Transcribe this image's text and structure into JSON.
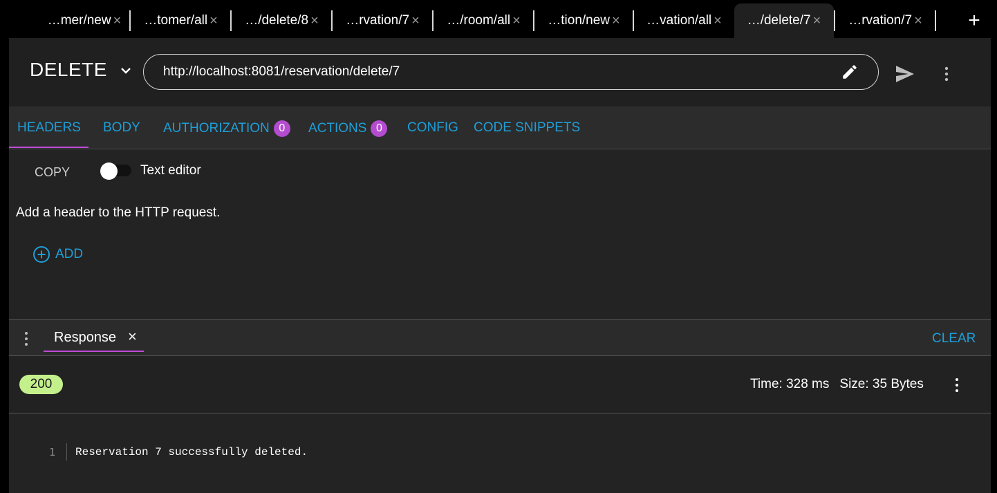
{
  "tabs": [
    {
      "label": "…mer/new",
      "active": false
    },
    {
      "label": "…tomer/all",
      "active": false
    },
    {
      "label": "…/delete/8",
      "active": false
    },
    {
      "label": "…rvation/7",
      "active": false
    },
    {
      "label": "…/room/all",
      "active": false
    },
    {
      "label": "…tion/new",
      "active": false
    },
    {
      "label": "…vation/all",
      "active": false
    },
    {
      "label": "…/delete/7",
      "active": true
    },
    {
      "label": "…rvation/7",
      "active": false
    }
  ],
  "tab_close_glyph": "×",
  "add_tab_glyph": "+",
  "request": {
    "method": "DELETE",
    "url": "http://localhost:8081/reservation/delete/7"
  },
  "subtabs": {
    "headers": "HEADERS",
    "body": "BODY",
    "authorization": "AUTHORIZATION",
    "authorization_count": "0",
    "actions": "ACTIONS",
    "actions_count": "0",
    "config": "CONFIG",
    "code_snippets": "CODE SNIPPETS"
  },
  "headers_panel": {
    "copy_label": "COPY",
    "text_editor_label": "Text editor",
    "help_text": "Add a header to the HTTP request.",
    "add_label": "ADD"
  },
  "response": {
    "tab_label": "Response",
    "close_glyph": "×",
    "clear_label": "CLEAR",
    "status_code": "200",
    "time_text": "Time: 328 ms",
    "size_text": "Size: 35 Bytes",
    "line_number": "1",
    "body_line": "Reservation 7 successfully deleted."
  },
  "colors": {
    "accent_blue": "#1e9fd9",
    "badge_purple": "#b44cd0",
    "underline_purple": "#c04bd8",
    "status_green": "#c4f08c"
  },
  "icons": [
    "chevron-down-icon",
    "edit-icon",
    "send-icon",
    "more-vert-icon",
    "add-circle-icon",
    "close-icon",
    "plus-icon"
  ]
}
